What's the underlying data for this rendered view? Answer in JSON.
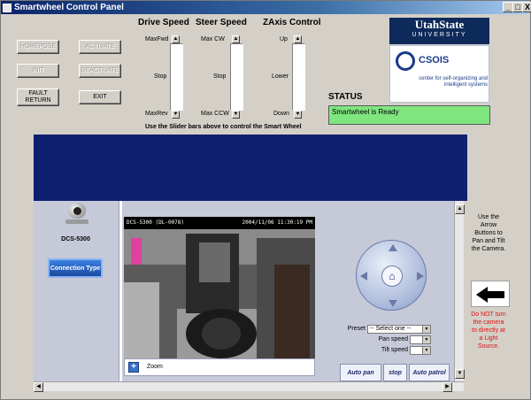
{
  "window": {
    "title": "Smartwheel Control Panel",
    "minimize": "_",
    "maximize": "□",
    "close": "X"
  },
  "left_buttons": [
    {
      "label": "HOMEPOSE",
      "enabled": false
    },
    {
      "label": "ACTIVATE",
      "enabled": false
    },
    {
      "label": "INIT",
      "enabled": false
    },
    {
      "label": "DEACTIVATE",
      "enabled": false
    },
    {
      "label": "FAULT RETURN",
      "enabled": true
    },
    {
      "label": "EXIT",
      "enabled": true
    }
  ],
  "drive_speed": {
    "title": "Drive Speed",
    "top": "MaxFwd",
    "mid": "Stop",
    "bottom": "MaxRev"
  },
  "steer_speed": {
    "title": "Steer Speed",
    "top": "Max CW",
    "mid": "Stop",
    "bottom": "Max CCW"
  },
  "zaxis": {
    "title": "ZAxis Control",
    "top": "Up",
    "mid": "Lower",
    "bottom": "Down"
  },
  "slider_hint": "Use the Slider bars above to control the Smart Wheel",
  "logos": {
    "usu_line1": "UtahState",
    "usu_line2": "UNIVERSITY",
    "csois_name": "CSOIS",
    "csois_tagline": "center for self-organizing and intelligent systems"
  },
  "status": {
    "label": "STATUS",
    "value": "Smartwheel is Ready"
  },
  "camera": {
    "model": "DCS-5300",
    "connection_button": "Connection Type",
    "overlay_left": "DCS-5300 (DL-0078)",
    "overlay_right": "2004/11/06 11:30:19 PM",
    "zoom_label": "Zoom",
    "zoom_icon": "plus-icon",
    "nav_icon": "home-icon",
    "preset_label": "Preset",
    "preset_value": "-- Select one --",
    "pan_speed_label": "Pan speed",
    "tilt_speed_label": "Tilt speed",
    "buttons": [
      "Auto pan",
      "stop",
      "Auto patrol"
    ]
  },
  "right_panel": {
    "instructions": "Use the Arrow Buttons to Pan and Tilt the Camera.",
    "arrow_icon": "arrow-left-icon",
    "warning": "Do NOT turn the camera to directly at a Light Source."
  }
}
